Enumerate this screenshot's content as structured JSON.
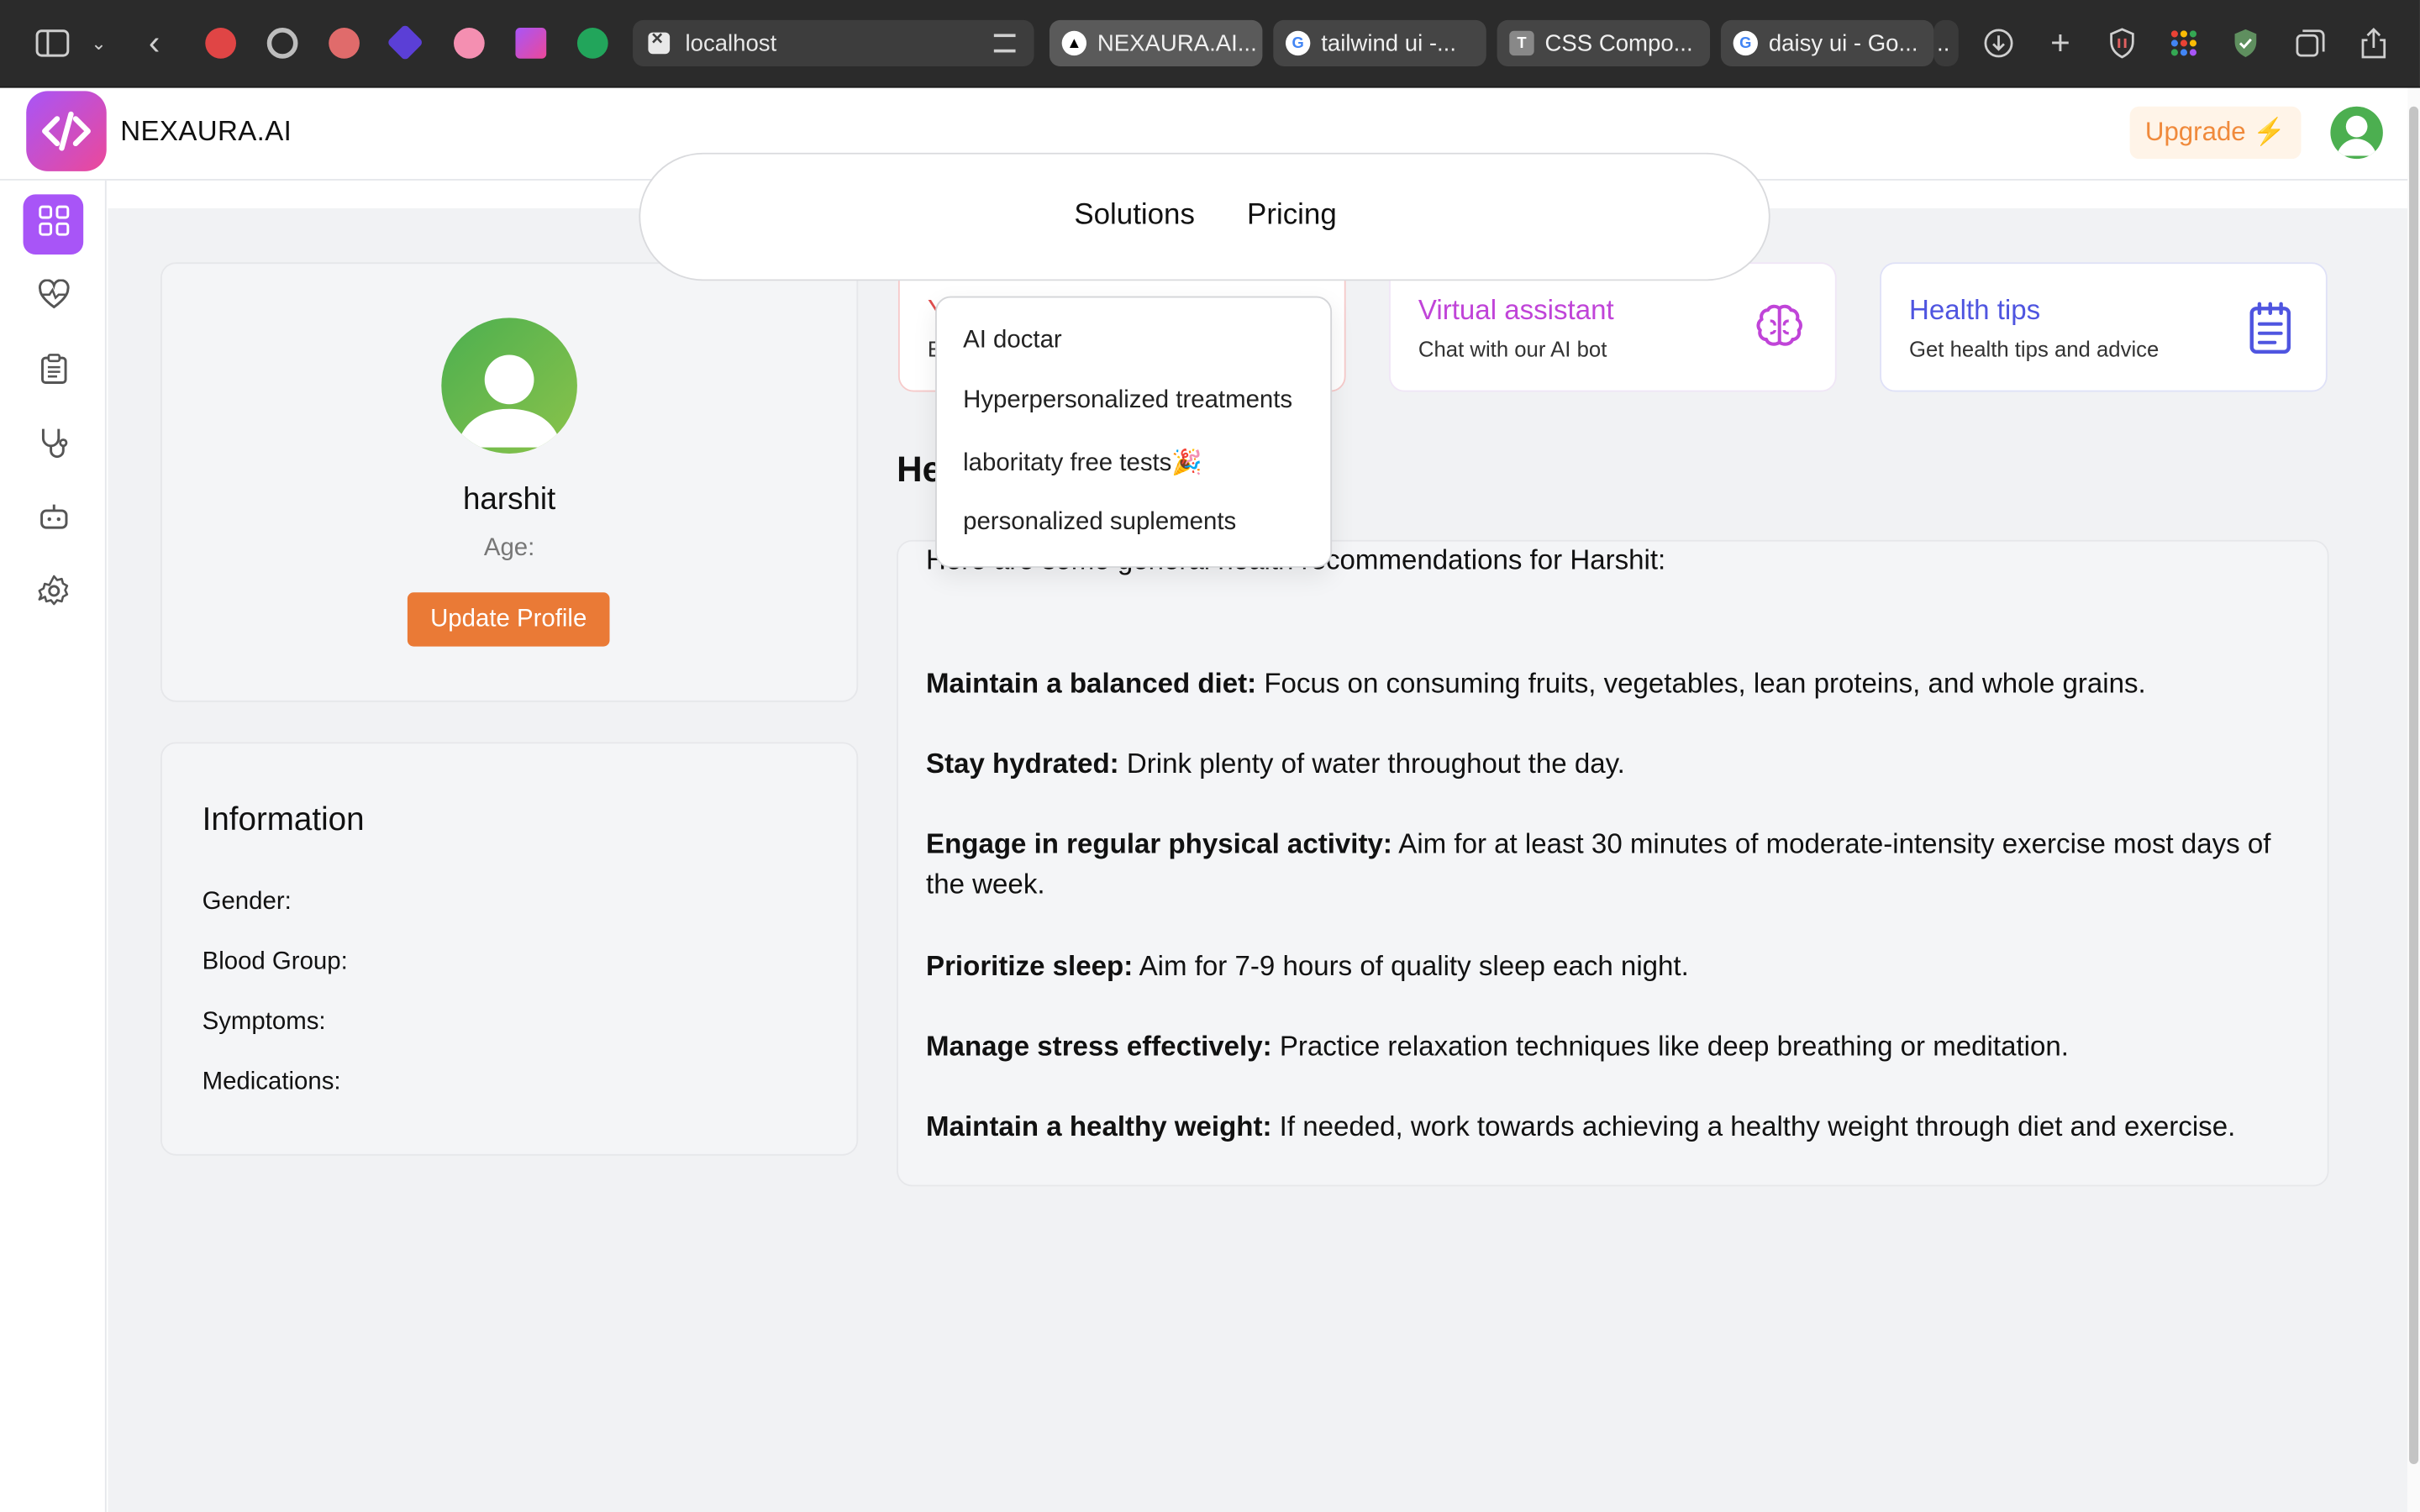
{
  "browser": {
    "url": "localhost",
    "tabs": [
      {
        "label": "NEXAURA.AI..."
      },
      {
        "label": "tailwind ui -..."
      },
      {
        "label": "CSS Compo..."
      },
      {
        "label": "daisy ui - Go..."
      }
    ],
    "tab_overflow": ".."
  },
  "header": {
    "brand": "NEXAURA.AI",
    "upgrade_label": "Upgrade ⚡"
  },
  "nav": {
    "solutions": "Solutions",
    "pricing": "Pricing",
    "dropdown": [
      "AI doctar",
      "Hyperpersonalized treatments",
      "laboritaty free tests🎉",
      "personalized suplements"
    ]
  },
  "profile": {
    "name": "harshit",
    "age_label": "Age:",
    "update_button": "Update Profile"
  },
  "information": {
    "title": "Information",
    "fields": [
      "Gender:",
      "Blood Group:",
      "Symptoms:",
      "Medications:"
    ]
  },
  "features": [
    {
      "title": "Y",
      "subtitle": "E",
      "color": "#e04e4e"
    },
    {
      "title": "Virtual assistant",
      "subtitle": "Chat with our AI bot",
      "color": "#c044d8",
      "icon": "brain-icon"
    },
    {
      "title": "Health tips",
      "subtitle": "Get health tips and advice",
      "color": "#4f55e0",
      "icon": "clipboard-icon"
    }
  ],
  "health": {
    "title": "He",
    "intro": "Here are some general health recommendations for Harshit:",
    "tips": [
      {
        "bold": "Maintain a balanced diet:",
        "text": " Focus on consuming fruits, vegetables, lean proteins, and whole grains."
      },
      {
        "bold": "Stay hydrated:",
        "text": " Drink plenty of water throughout the day."
      },
      {
        "bold": "Engage in regular physical activity:",
        "text": " Aim for at least 30 minutes of moderate-intensity exercise most days of the week."
      },
      {
        "bold": "Prioritize sleep:",
        "text": " Aim for 7-9 hours of quality sleep each night."
      },
      {
        "bold": "Manage stress effectively:",
        "text": " Practice relaxation techniques like deep breathing or meditation."
      },
      {
        "bold": "Maintain a healthy weight:",
        "text": " If needed, work towards achieving a healthy weight through diet and exercise."
      }
    ]
  },
  "sidebar": {
    "items": [
      {
        "icon": "dashboard-icon",
        "active": true
      },
      {
        "icon": "heartbeat-icon"
      },
      {
        "icon": "report-icon"
      },
      {
        "icon": "stethoscope-icon"
      },
      {
        "icon": "robot-icon"
      },
      {
        "icon": "settings-icon"
      }
    ]
  },
  "colors": {
    "accent": "#a855f7",
    "upgrade": "#f08a3c",
    "update_button": "#ea7a36"
  }
}
